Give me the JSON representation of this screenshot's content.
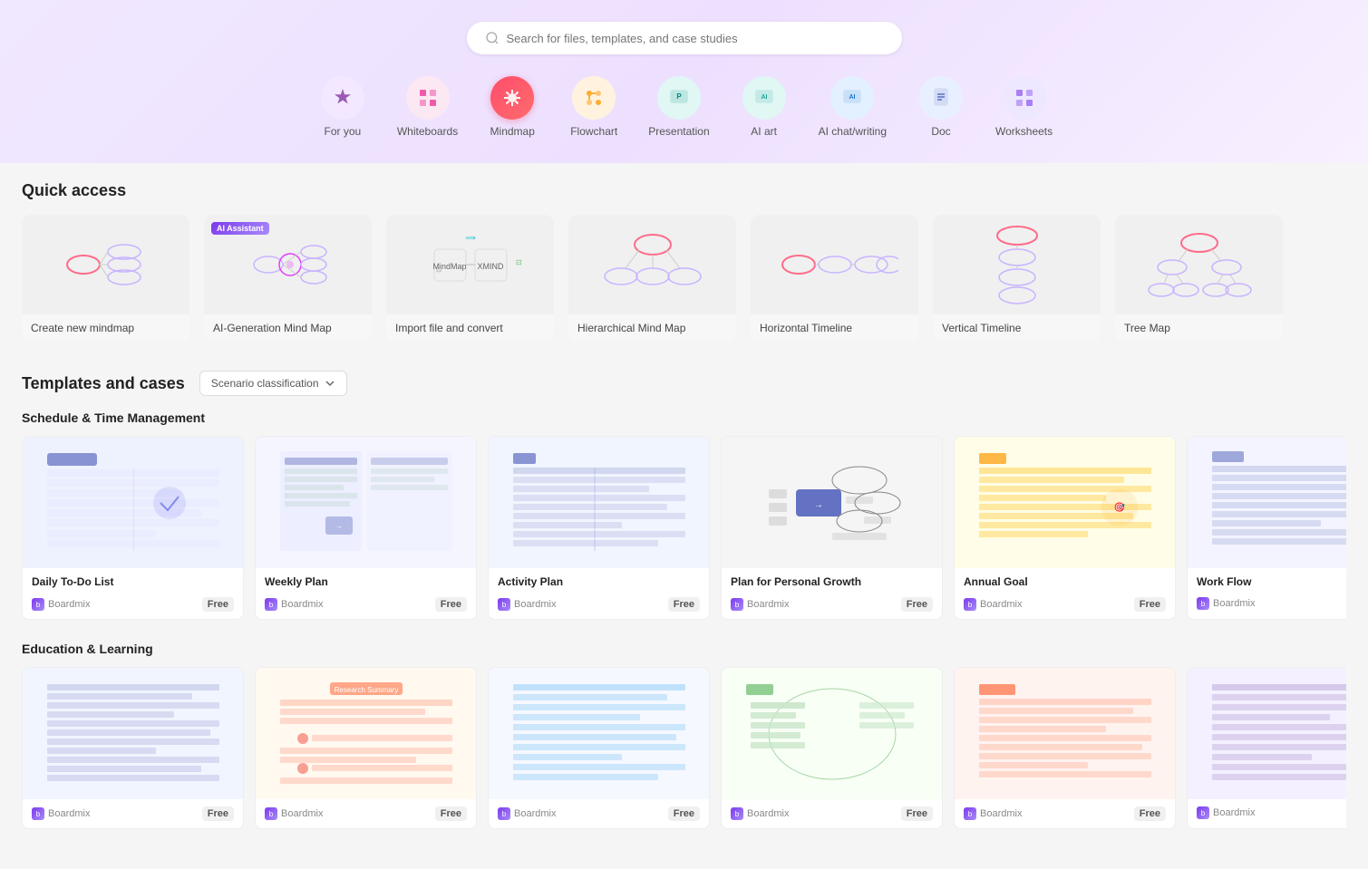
{
  "hero": {
    "search_placeholder": "Search for files, templates, and case studies"
  },
  "nav": {
    "items": [
      {
        "id": "for-you",
        "label": "For you",
        "icon": "✦",
        "icon_bg": "purple",
        "active": false
      },
      {
        "id": "whiteboards",
        "label": "Whiteboards",
        "icon": "⊞",
        "icon_bg": "pink",
        "active": false
      },
      {
        "id": "mindmap",
        "label": "Mindmap",
        "icon": "⊛",
        "icon_bg": "active",
        "active": true
      },
      {
        "id": "flowchart",
        "label": "Flowchart",
        "icon": "❋",
        "icon_bg": "orange",
        "active": false
      },
      {
        "id": "presentation",
        "label": "Presentation",
        "icon": "P",
        "icon_bg": "teal",
        "active": false
      },
      {
        "id": "ai-art",
        "label": "AI art",
        "icon": "✦",
        "icon_bg": "teal",
        "active": false
      },
      {
        "id": "ai-chat",
        "label": "AI chat/writing",
        "icon": "AI",
        "icon_bg": "blue",
        "active": false
      },
      {
        "id": "doc",
        "label": "Doc",
        "icon": "≡",
        "icon_bg": "blue2",
        "active": false
      },
      {
        "id": "worksheets",
        "label": "Worksheets",
        "icon": "⊞",
        "icon_bg": "indigo",
        "active": false
      }
    ]
  },
  "quick_access": {
    "title": "Quick access",
    "items": [
      {
        "id": "create-new",
        "label": "Create new mindmap"
      },
      {
        "id": "ai-gen",
        "label": "AI-Generation Mind Map",
        "badge": "AI Assistant"
      },
      {
        "id": "import",
        "label": "Import file and convert"
      },
      {
        "id": "hierarchical",
        "label": "Hierarchical Mind Map"
      },
      {
        "id": "horizontal",
        "label": "Horizontal Timeline"
      },
      {
        "id": "vertical",
        "label": "Vertical Timeline"
      },
      {
        "id": "tree",
        "label": "Tree Map"
      }
    ]
  },
  "templates": {
    "title": "Templates and cases",
    "dropdown_label": "Scenario classification",
    "sections": [
      {
        "id": "schedule",
        "title": "Schedule & Time Management",
        "items": [
          {
            "id": "daily-todo",
            "name": "Daily To-Do List",
            "brand": "Boardmix",
            "free": true
          },
          {
            "id": "weekly-plan",
            "name": "Weekly Plan",
            "brand": "Boardmix",
            "free": true
          },
          {
            "id": "activity-plan",
            "name": "Activity Plan",
            "brand": "Boardmix",
            "free": true
          },
          {
            "id": "personal-growth",
            "name": "Plan for Personal Growth",
            "brand": "Boardmix",
            "free": true
          },
          {
            "id": "annual-goal",
            "name": "Annual Goal",
            "brand": "Boardmix",
            "free": true
          },
          {
            "id": "workflow",
            "name": "Work Flow",
            "brand": "Boardmix",
            "free": false
          }
        ]
      },
      {
        "id": "education",
        "title": "Education & Learning",
        "items": [
          {
            "id": "edu1",
            "name": "",
            "brand": "Boardmix",
            "free": true
          },
          {
            "id": "edu2",
            "name": "",
            "brand": "Boardmix",
            "free": true
          },
          {
            "id": "edu3",
            "name": "",
            "brand": "Boardmix",
            "free": true
          },
          {
            "id": "edu4",
            "name": "",
            "brand": "Boardmix",
            "free": true
          },
          {
            "id": "edu5",
            "name": "",
            "brand": "Boardmix",
            "free": true
          },
          {
            "id": "edu6",
            "name": "",
            "brand": "Boardmix",
            "free": false
          }
        ]
      }
    ]
  },
  "labels": {
    "free": "Free",
    "brand": "Boardmix"
  }
}
